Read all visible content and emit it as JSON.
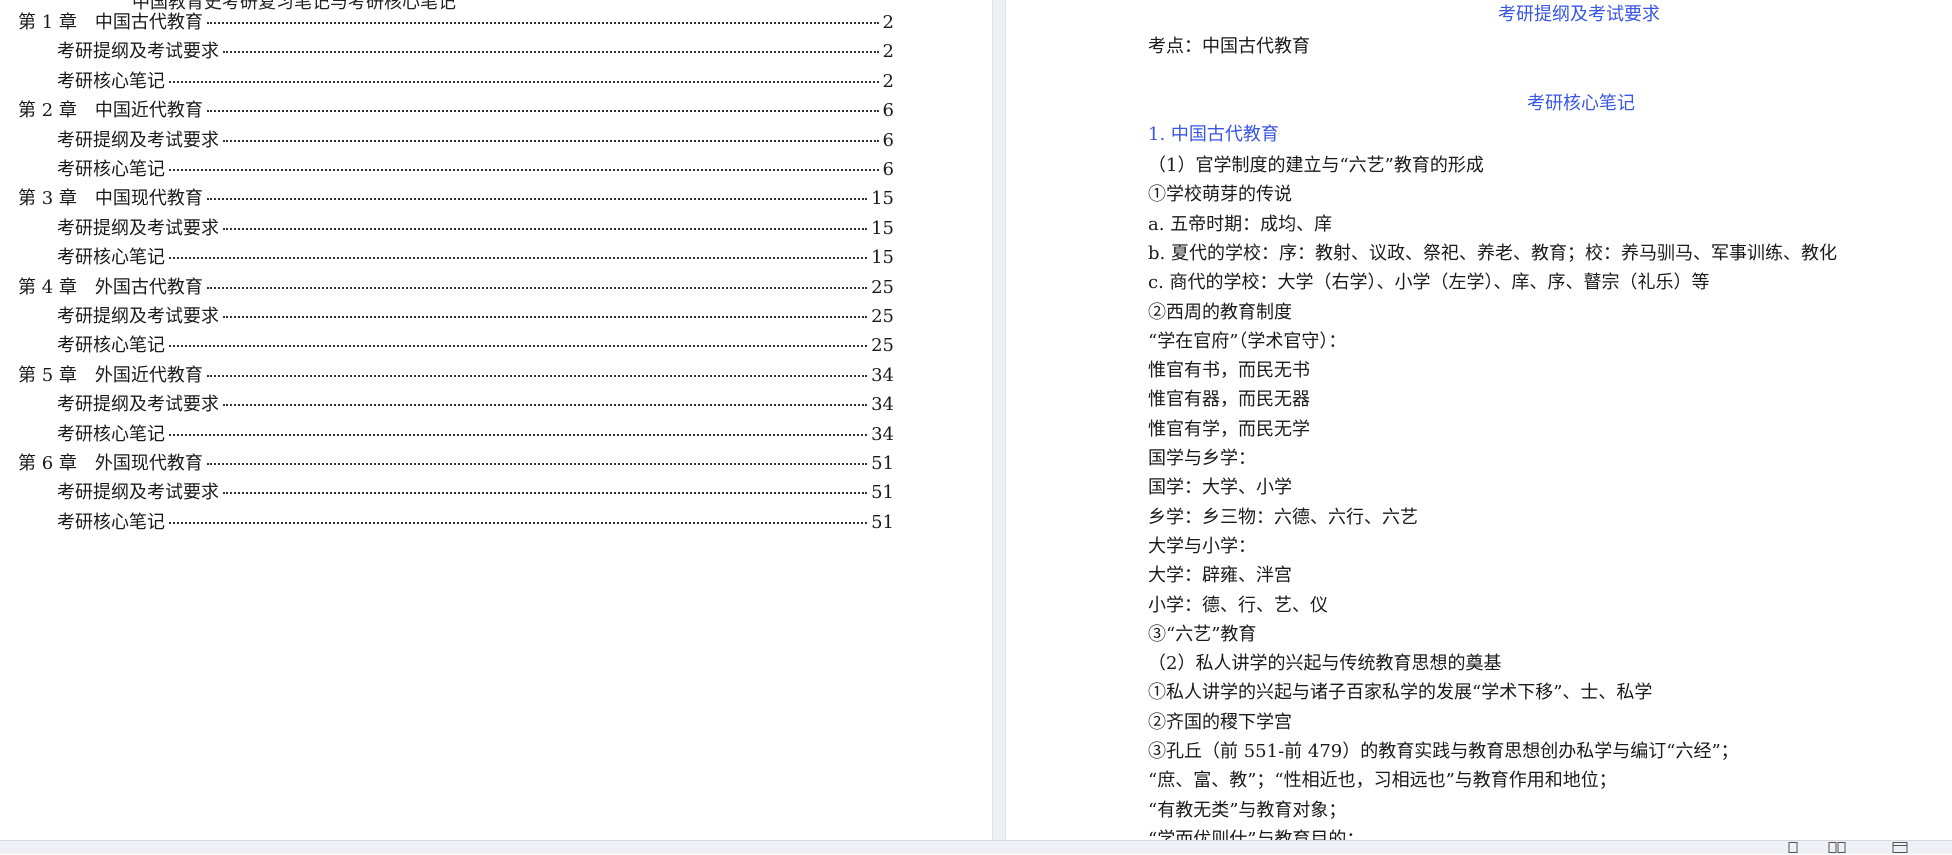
{
  "left_page": {
    "cutoff_title": "中国教育史考研复习笔记与考研核心笔记",
    "toc": [
      {
        "kind": "chapter",
        "chapter": "第 1 章",
        "title": "中国古代教育",
        "page": "2"
      },
      {
        "kind": "section",
        "title": "考研提纲及考试要求",
        "page": "2"
      },
      {
        "kind": "section",
        "title": "考研核心笔记",
        "page": "2"
      },
      {
        "kind": "chapter",
        "chapter": "第 2 章",
        "title": "中国近代教育",
        "page": "6"
      },
      {
        "kind": "section",
        "title": "考研提纲及考试要求",
        "page": "6"
      },
      {
        "kind": "section",
        "title": "考研核心笔记",
        "page": "6"
      },
      {
        "kind": "chapter",
        "chapter": "第 3 章",
        "title": "中国现代教育",
        "page": "15"
      },
      {
        "kind": "section",
        "title": "考研提纲及考试要求",
        "page": "15"
      },
      {
        "kind": "section",
        "title": "考研核心笔记",
        "page": "15"
      },
      {
        "kind": "chapter",
        "chapter": "第 4 章",
        "title": "外国古代教育",
        "page": "25"
      },
      {
        "kind": "section",
        "title": "考研提纲及考试要求",
        "page": "25"
      },
      {
        "kind": "section",
        "title": "考研核心笔记",
        "page": "25"
      },
      {
        "kind": "chapter",
        "chapter": "第 5 章",
        "title": "外国近代教育",
        "page": "34"
      },
      {
        "kind": "section",
        "title": "考研提纲及考试要求",
        "page": "34"
      },
      {
        "kind": "section",
        "title": "考研核心笔记",
        "page": "34"
      },
      {
        "kind": "chapter",
        "chapter": "第 6 章",
        "title": "外国现代教育",
        "page": "51"
      },
      {
        "kind": "section",
        "title": "考研提纲及考试要求",
        "page": "51"
      },
      {
        "kind": "section",
        "title": "考研核心笔记",
        "page": "51"
      }
    ]
  },
  "right_page": {
    "heading_outline": "考研提纲及考试要求",
    "exam_point": "考点：中国古代教育",
    "heading_notes": "考研核心笔记",
    "section_title": "1. 中国古代教育",
    "lines": [
      "（1）官学制度的建立与“六艺”教育的形成",
      "①学校萌芽的传说",
      "a. 五帝时期：成均、庠",
      "b. 夏代的学校：序：教射、议政、祭祀、养老、教育；校：养马驯马、军事训练、教化",
      "c. 商代的学校：大学（右学）、小学（左学）、庠、序、瞽宗（礼乐）等",
      "②西周的教育制度",
      "“学在官府”（学术官守）：",
      "惟官有书，而民无书",
      "惟官有器，而民无器",
      "惟官有学，而民无学",
      "国学与乡学：",
      "国学：大学、小学",
      "乡学：乡三物：六德、六行、六艺",
      "大学与小学：",
      "大学：辟雍、泮宫",
      "小学：德、行、艺、仪",
      "③“六艺”教育",
      "（2）私人讲学的兴起与传统教育思想的奠基",
      "①私人讲学的兴起与诸子百家私学的发展“学术下移”、士、私学",
      "②齐国的稷下学宫",
      "③孔丘（前 551-前 479）的教育实践与教育思想创办私学与编订“六经”；",
      "“庶、富、教”；“性相近也，习相远也”与教育作用和地位；",
      "“有教无类”与教育对象；",
      "“学而优则仕”与教育目的；"
    ]
  },
  "status_bar": {
    "icons": [
      "single-page-view-icon",
      "two-page-view-icon",
      "web-layout-icon"
    ]
  }
}
